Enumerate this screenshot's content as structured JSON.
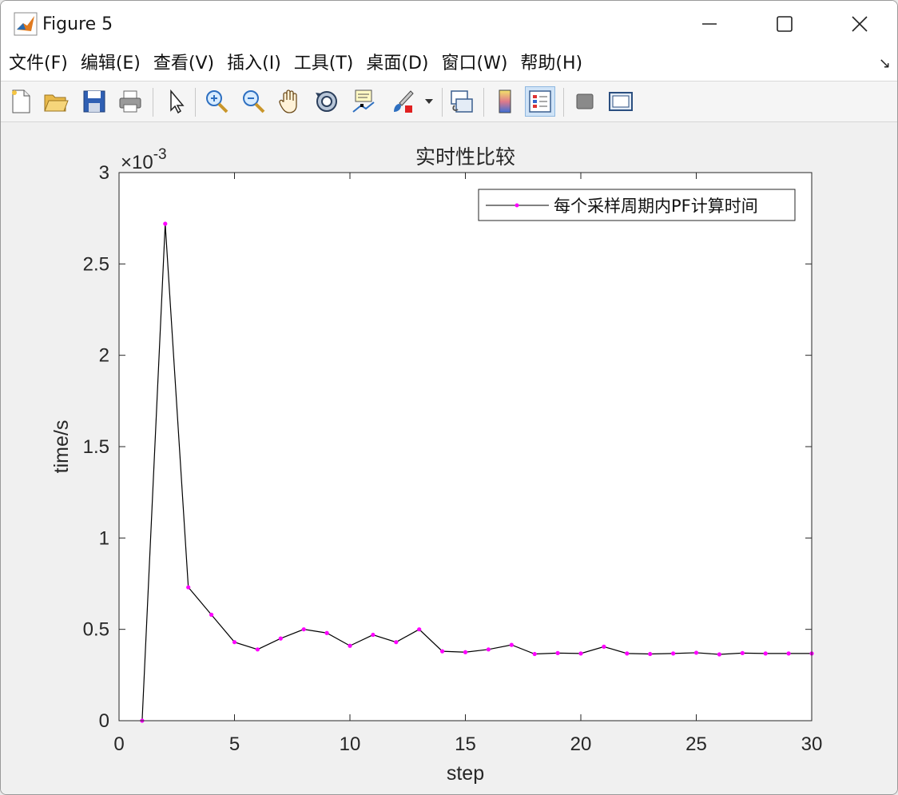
{
  "window": {
    "title": "Figure 5"
  },
  "menu": {
    "items": [
      "文件(F)",
      "编辑(E)",
      "查看(V)",
      "插入(I)",
      "工具(T)",
      "桌面(D)",
      "窗口(W)",
      "帮助(H)"
    ],
    "overflow_arrow": "↘"
  },
  "toolbar": {
    "tools": [
      {
        "name": "new-figure-icon"
      },
      {
        "name": "open-file-icon"
      },
      {
        "name": "save-icon"
      },
      {
        "name": "print-icon"
      },
      {
        "name": "select-pointer-icon"
      },
      {
        "name": "zoom-in-icon"
      },
      {
        "name": "zoom-out-icon"
      },
      {
        "name": "pan-hand-icon"
      },
      {
        "name": "rotate-3d-icon"
      },
      {
        "name": "data-cursor-icon"
      },
      {
        "name": "brush-icon"
      },
      {
        "name": "link-plot-icon"
      },
      {
        "name": "colorbar-icon"
      },
      {
        "name": "legend-icon",
        "active": true
      },
      {
        "name": "hide-plot-tools-icon"
      },
      {
        "name": "show-plot-tools-icon"
      }
    ]
  },
  "chart_data": {
    "type": "line",
    "title": "实时性比较",
    "xlabel": "step",
    "ylabel": "time/s",
    "y_exponent_label": "×10",
    "y_exponent_power": "-3",
    "xlim": [
      0,
      30
    ],
    "ylim": [
      0,
      3
    ],
    "x_ticks": [
      "0",
      "5",
      "10",
      "15",
      "20",
      "25",
      "30"
    ],
    "x_tick_values": [
      0,
      5,
      10,
      15,
      20,
      25,
      30
    ],
    "y_ticks": [
      "0",
      "0.5",
      "1",
      "1.5",
      "2",
      "2.5",
      "3"
    ],
    "y_tick_values": [
      0,
      0.5,
      1,
      1.5,
      2,
      2.5,
      3
    ],
    "grid": false,
    "legend_position": "top-right",
    "line_color": "#000000",
    "marker_color": "#ff00ff",
    "series": [
      {
        "name": "每个采样周期内PF计算时间",
        "x": [
          1,
          2,
          3,
          4,
          5,
          6,
          7,
          8,
          9,
          10,
          11,
          12,
          13,
          14,
          15,
          16,
          17,
          18,
          19,
          20,
          21,
          22,
          23,
          24,
          25,
          26,
          27,
          28,
          29,
          30
        ],
        "values": [
          0,
          2.72,
          0.73,
          0.58,
          0.43,
          0.39,
          0.45,
          0.5,
          0.48,
          0.41,
          0.47,
          0.43,
          0.5,
          0.38,
          0.375,
          0.39,
          0.415,
          0.365,
          0.37,
          0.368,
          0.405,
          0.368,
          0.365,
          0.368,
          0.372,
          0.363,
          0.37,
          0.368,
          0.368,
          0.368
        ]
      }
    ]
  }
}
